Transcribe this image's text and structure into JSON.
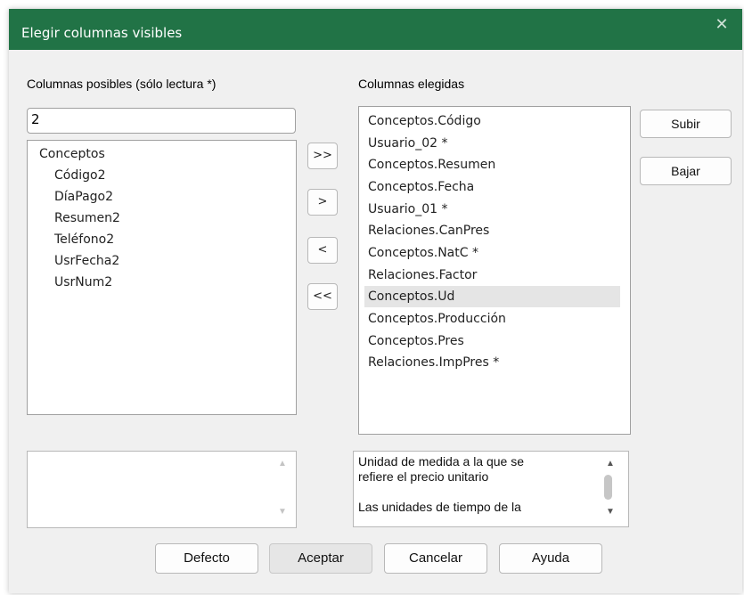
{
  "window": {
    "title": "Elegir columnas visibles",
    "close_glyph": "✕"
  },
  "available": {
    "label": "Columnas posibles (sólo lectura *)",
    "filter_value": "2",
    "root": "Conceptos",
    "children": [
      "Código2",
      "DíaPago2",
      "Resumen2",
      "Teléfono2",
      "UsrFecha2",
      "UsrNum2"
    ]
  },
  "chosen": {
    "label": "Columnas elegidas",
    "items": [
      "Conceptos.Código",
      "Usuario_02 *",
      "Conceptos.Resumen",
      "Conceptos.Fecha",
      "Usuario_01 *",
      "Relaciones.CanPres",
      "Conceptos.NatC *",
      "Relaciones.Factor",
      "Conceptos.Ud",
      "Conceptos.Producción",
      "Conceptos.Pres",
      "Relaciones.ImpPres *"
    ],
    "selected_index": 8
  },
  "transfer_buttons": {
    "add_all": ">>",
    "add": ">",
    "remove": "<",
    "remove_all": "<<"
  },
  "side_buttons": {
    "up": "Subir",
    "down": "Bajar"
  },
  "description": {
    "lines": [
      "Unidad de medida a la que se",
      "refiere el precio unitario",
      "",
      "Las unidades de tiempo de la"
    ]
  },
  "footer": {
    "default": "Defecto",
    "accept": "Aceptar",
    "cancel": "Cancelar",
    "help": "Ayuda"
  },
  "colors": {
    "titlebar": "#217346",
    "selection": "#e5e5e5"
  }
}
